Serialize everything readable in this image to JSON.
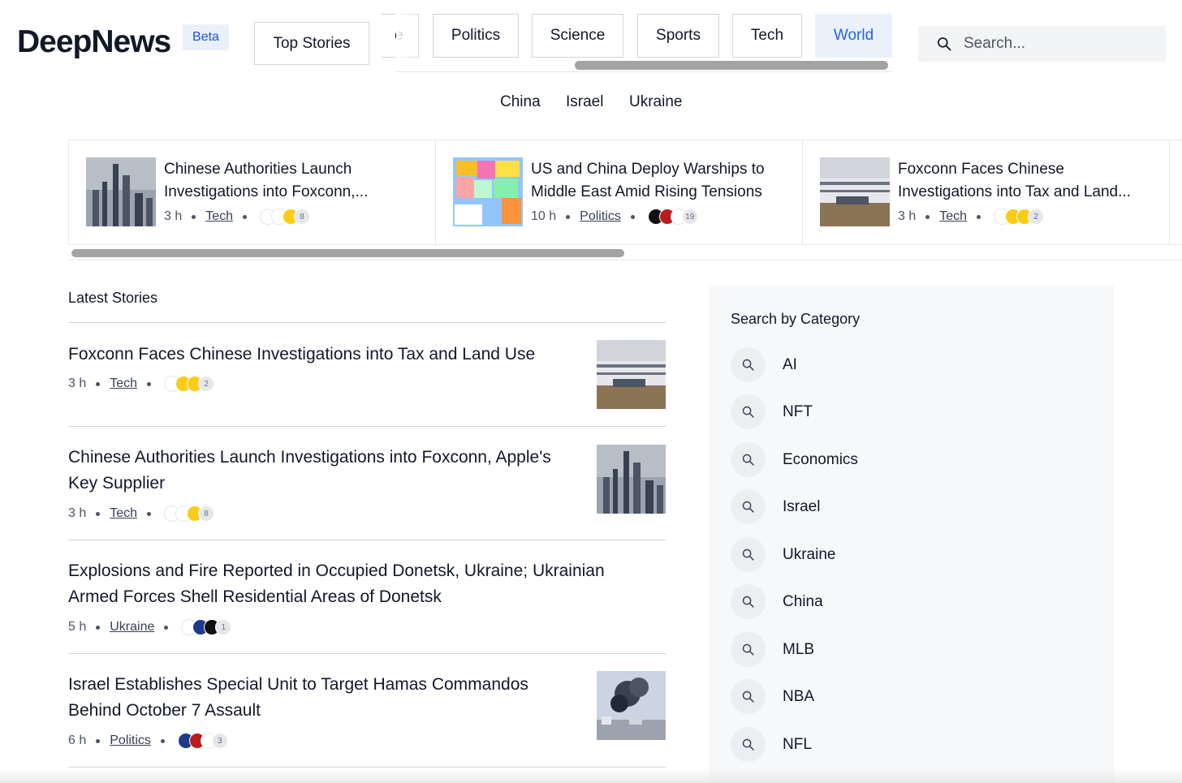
{
  "brand": {
    "name": "DeepNews",
    "badge": "Beta"
  },
  "nav": {
    "top_stories": "Top Stories",
    "tabs": [
      {
        "label": "e"
      },
      {
        "label": "Politics"
      },
      {
        "label": "Science"
      },
      {
        "label": "Sports"
      },
      {
        "label": "Tech"
      },
      {
        "label": "World"
      }
    ],
    "subtabs": [
      "China",
      "Israel",
      "Ukraine"
    ]
  },
  "search": {
    "placeholder": "Search..."
  },
  "carousel": [
    {
      "title": "Chinese Authorities Launch Investigations into Foxconn,...",
      "time": "3 h",
      "category": "Tech",
      "source_count": "8"
    },
    {
      "title": "US and China Deploy Warships to Middle East Amid Rising Tensions",
      "time": "10 h",
      "category": "Politics",
      "source_count": "19"
    },
    {
      "title": "Foxconn Faces Chinese Investigations into Tax and Land...",
      "time": "3 h",
      "category": "Tech",
      "source_count": "2"
    }
  ],
  "latest": {
    "heading": "Latest Stories",
    "stories": [
      {
        "title": "Foxconn Faces Chinese Investigations into Tax and Land Use",
        "time": "3 h",
        "category": "Tech",
        "source_count": "2"
      },
      {
        "title": "Chinese Authorities Launch Investigations into Foxconn, Apple's Key Supplier",
        "time": "3 h",
        "category": "Tech",
        "source_count": "8"
      },
      {
        "title": "Explosions and Fire Reported in Occupied Donetsk, Ukraine; Ukrainian Armed Forces Shell Residential Areas of Donetsk",
        "time": "5 h",
        "category": "Ukraine",
        "source_count": "1"
      },
      {
        "title": "Israel Establishes Special Unit to Target Hamas Commandos Behind October 7 Assault",
        "time": "6 h",
        "category": "Politics",
        "source_count": "3"
      }
    ]
  },
  "sidebar": {
    "heading": "Search by Category",
    "categories": [
      "AI",
      "NFT",
      "Economics",
      "Israel",
      "Ukraine",
      "China",
      "MLB",
      "NBA",
      "NFL"
    ]
  },
  "colors": {
    "accent": "#2563eb",
    "active_tab_bg": "#eaf1fb",
    "sidebar_bg": "#f7f8fa"
  }
}
